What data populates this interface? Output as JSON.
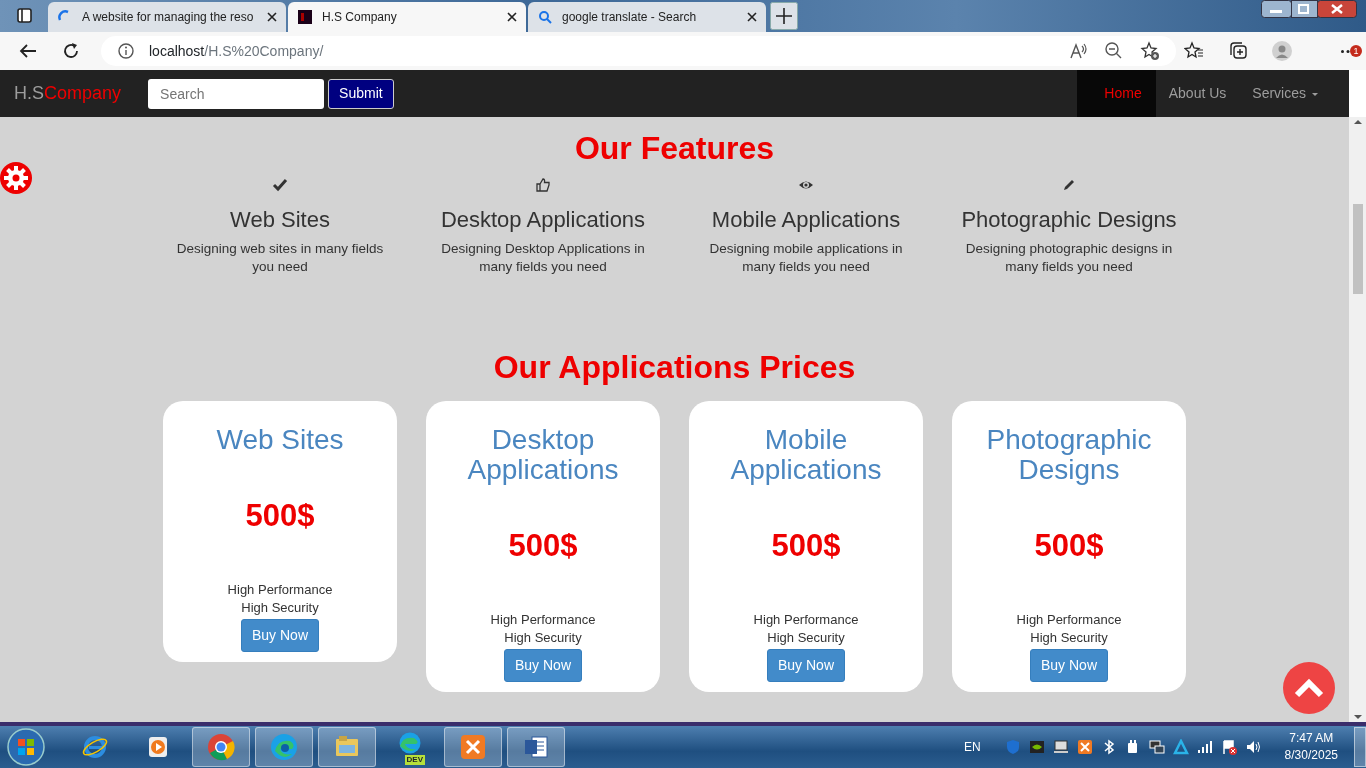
{
  "browser": {
    "tabs": [
      {
        "title": "A website for managing the reso",
        "kind": "loader",
        "selected": false
      },
      {
        "title": "H.S Company",
        "kind": "favicon",
        "selected": true
      },
      {
        "title": "google translate - Search",
        "kind": "search",
        "selected": false
      }
    ],
    "url_host": "localhost",
    "url_path": "/H.S%20Company/",
    "notification_badge": "1"
  },
  "navbar": {
    "brand_first": "H.S",
    "brand_second": "Company",
    "search": {
      "placeholder": "Search"
    },
    "submit": "Submit",
    "items": [
      {
        "label": "Home",
        "selected": true,
        "dropdown": false
      },
      {
        "label": "About Us",
        "selected": false,
        "dropdown": false
      },
      {
        "label": "Services",
        "selected": false,
        "dropdown": true
      }
    ]
  },
  "features": {
    "title": "Our Features",
    "items": [
      {
        "kind": "check",
        "title": "Web Sites",
        "text": "Designing web sites in many fields you need"
      },
      {
        "kind": "thumbs-up",
        "title": "Desktop Applications",
        "text": "Designing Desktop Applications in many fields you need"
      },
      {
        "kind": "eye",
        "title": "Mobile Applications",
        "text": "Designing mobile applications in many fields you need"
      },
      {
        "kind": "pencil",
        "title": "Photographic Designs",
        "text": "Designing photographic designs in many fields you need"
      }
    ]
  },
  "prices": {
    "title": "Our Applications Prices",
    "cards": [
      {
        "title": "Web Sites",
        "price": "500$",
        "lines": [
          "High Performance",
          "High Security"
        ],
        "button": "Buy Now"
      },
      {
        "title": "Desktop Applications",
        "price": "500$",
        "lines": [
          "High Performance",
          "High Security"
        ],
        "button": "Buy Now"
      },
      {
        "title": "Mobile Applications",
        "price": "500$",
        "lines": [
          "High Performance",
          "High Security"
        ],
        "button": "Buy Now"
      },
      {
        "title": "Photographic Designs",
        "price": "500$",
        "lines": [
          "High Performance",
          "High Security"
        ],
        "button": "Buy Now"
      }
    ]
  },
  "taskbar": {
    "apps": [
      {
        "kind": "ie"
      },
      {
        "kind": "media"
      },
      {
        "kind": "chrome",
        "open": true
      },
      {
        "kind": "edge",
        "open": true
      },
      {
        "kind": "explorer",
        "open": true
      },
      {
        "kind": "edge-dev",
        "badge": "DEV"
      },
      {
        "kind": "xampp",
        "open": true
      },
      {
        "kind": "word",
        "open": true
      }
    ],
    "language": "EN",
    "time": "7:47 AM",
    "date": "8/30/2025"
  }
}
